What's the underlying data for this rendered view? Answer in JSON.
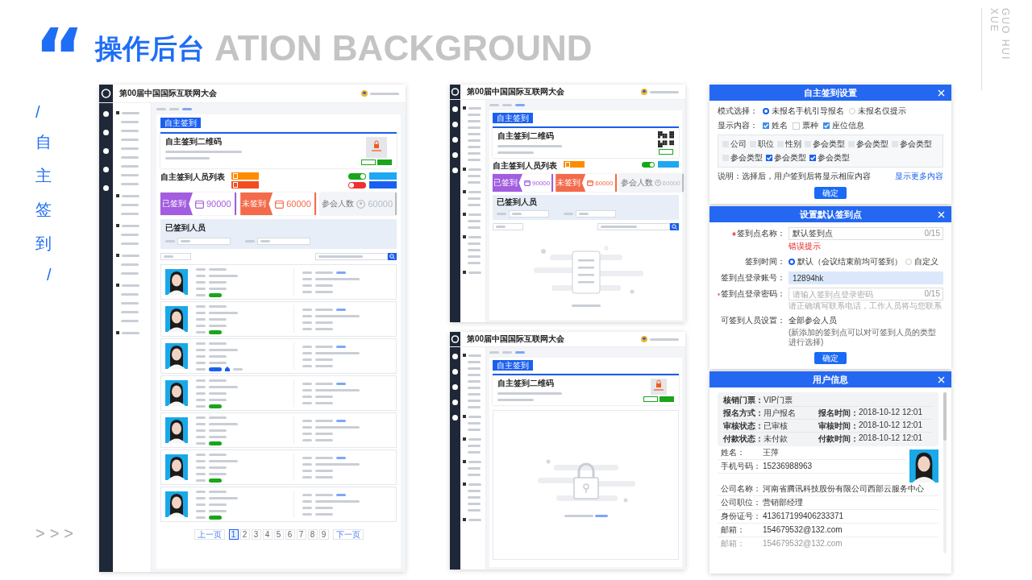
{
  "header": {
    "quote_mark": "“",
    "title": "操作后台",
    "backdrop": "ATION BACKGROUND",
    "author": "GUO HUI XUE"
  },
  "side_label": {
    "slash_top": "/",
    "text": "自主签到",
    "slash_bottom": "/",
    "arrows": ">>>"
  },
  "mockups": [
    {
      "kind": "list",
      "title": "第00届中国国际互联网大会",
      "tab": "自主签到",
      "qr_title": "自主签到二维码",
      "qr": {
        "kind": "placeholder"
      },
      "list_title": "自主签到人员列表",
      "export_buttons": [
        {
          "color": "#ff8c00"
        },
        {
          "color": "#f24d1f"
        }
      ],
      "switches": [
        {
          "on": true
        },
        {
          "on": false
        }
      ],
      "settings_buttons": [
        {
          "color": "#1ea7f2"
        },
        {
          "color": "#1a5ff0"
        }
      ],
      "stats": [
        {
          "kind": "highlight",
          "label": "已签到",
          "value": "90000",
          "color": "#a25de0"
        },
        {
          "kind": "highlight",
          "label": "未签到",
          "value": "60000",
          "color": "#f46a4a"
        },
        {
          "kind": "plain",
          "label": "参会人数",
          "value": "60000",
          "color": "#b5bcc6"
        }
      ],
      "filter_title": "已签到人员",
      "records": [
        {
          "kind": "plain",
          "color": "#1aa51a"
        },
        {
          "kind": "plain",
          "color": "#1aa51a"
        },
        {
          "kind": "venue",
          "color": "#1a5ff0"
        },
        {
          "kind": "plain",
          "color": "#1aa51a"
        },
        {
          "kind": "plain",
          "color": "#1aa51a"
        },
        {
          "kind": "plain",
          "color": "#1aa51a"
        },
        {
          "kind": "plain",
          "color": "#1aa51a"
        }
      ],
      "pagination": {
        "prev": "上一页",
        "pages": [
          {
            "label": "1",
            "selected": true
          },
          {
            "label": "2",
            "selected": false
          },
          {
            "label": "3",
            "selected": false
          },
          {
            "label": "4",
            "selected": false
          },
          {
            "label": "5",
            "selected": false
          },
          {
            "label": "6",
            "selected": false
          },
          {
            "label": "7",
            "selected": false
          },
          {
            "label": "8",
            "selected": false
          },
          {
            "label": "9",
            "selected": false
          }
        ],
        "next": "下一页"
      }
    },
    {
      "kind": "empty",
      "title": "第00届中国国际互联网大会",
      "tab": "自主签到",
      "qr_title": "自主签到二维码",
      "qr": {
        "kind": "code"
      },
      "list_title": "自主签到人员列表",
      "export_buttons": [
        {
          "color": "#ff8c00"
        }
      ],
      "switches": [
        {
          "on": true
        }
      ],
      "settings_buttons": [
        {
          "color": "#1ea7f2"
        }
      ],
      "stats": [
        {
          "kind": "highlight",
          "label": "已签到",
          "value": "90000",
          "color": "#a25de0"
        },
        {
          "kind": "highlight",
          "label": "未签到",
          "value": "60000",
          "color": "#f46a4a"
        },
        {
          "kind": "plain",
          "label": "参会人数",
          "value": "60000",
          "color": "#b5bcc6"
        }
      ],
      "filter_title": "已签到人员"
    },
    {
      "kind": "locked",
      "title": "第00届中国国际互联网大会",
      "tab": "自主签到",
      "qr_title": "自主签到二维码",
      "qr": {
        "kind": "placeholder"
      }
    }
  ],
  "dialogs": [
    {
      "kind": "checkin_settings",
      "title": "自主签到设置",
      "mode": {
        "label": "模式选择：",
        "options": [
          {
            "label": "未报名手机引导报名",
            "selected": true
          },
          {
            "label": "未报名仅提示",
            "selected": false
          }
        ]
      },
      "display": {
        "label": "显示内容：",
        "options": [
          {
            "label": "姓名",
            "checked": true
          },
          {
            "label": "票种",
            "checked": false
          },
          {
            "label": "座位信息",
            "checked": true
          }
        ]
      },
      "fields": [
        {
          "label": "公司",
          "checked": false
        },
        {
          "label": "职位",
          "checked": false
        },
        {
          "label": "性别",
          "checked": false
        },
        {
          "label": "参会类型",
          "checked": false
        },
        {
          "label": "参会类型",
          "checked": false
        },
        {
          "label": "参会类型",
          "checked": false
        },
        {
          "label": "参会类型",
          "checked": false
        },
        {
          "label": "参会类型",
          "checked": true
        },
        {
          "label": "参会类型",
          "checked": true
        }
      ],
      "note": "说明：选择后，用户签到后将显示相应内容",
      "more_link": "显示更多内容",
      "button": "确定"
    },
    {
      "kind": "checkpoint",
      "title": "设置默认签到点",
      "rows": [
        {
          "kind": "input",
          "label": "签到点名称：",
          "required": true,
          "value": "默认签到点",
          "counter": "0/15",
          "error": "错误提示"
        },
        {
          "kind": "radio",
          "label": "签到时间：",
          "options": [
            {
              "label": "默认（会议结束前均可签到）",
              "selected": true
            },
            {
              "label": "自定义",
              "selected": false
            }
          ]
        },
        {
          "kind": "input",
          "label": "签到点登录账号：",
          "required": false,
          "value": "12894hk",
          "focused": true
        },
        {
          "kind": "input",
          "label": "签到点登录密码：",
          "required": true,
          "placeholder": "请输入签到点登录密码",
          "counter": "0/15",
          "hint": "请正确填写联系电话，工作人员将与您联系"
        },
        {
          "kind": "text",
          "label": "可签到人员设置：",
          "value": "全部参会人员",
          "note": "(新添加的签到点可以对可签到人员的类型进行选择)"
        }
      ],
      "button": "确定"
    },
    {
      "kind": "user_info",
      "title": "用户信息",
      "summary": [
        [
          {
            "label": "核销门票：",
            "value": "VIP门票"
          }
        ],
        [
          {
            "label": "报名方式：",
            "value": "用户报名"
          },
          {
            "label": "报名时间：",
            "value": "2018-10-12  12:01"
          }
        ],
        [
          {
            "label": "审核状态：",
            "value": "已审核"
          },
          {
            "label": "审核时间：",
            "value": "2018-10-12  12:01"
          }
        ],
        [
          {
            "label": "付款状态：",
            "value": "未付款"
          },
          {
            "label": "付款时间：",
            "value": "2018-10-12  12:01"
          }
        ]
      ],
      "details": [
        {
          "label": "姓名：",
          "value": "王萍"
        },
        {
          "label": "手机号码：",
          "value": "15236988963"
        },
        {
          "label": "公司名称：",
          "value": "河南省腾讯科技股份有限公司西部云服务中心"
        },
        {
          "label": "公司职位：",
          "value": "营销部经理"
        },
        {
          "label": "身份证号：",
          "value": "413617199406233371"
        },
        {
          "label": "邮箱：",
          "value": "154679532@132.com"
        },
        {
          "label": "邮箱：",
          "value": "154679532@132.com"
        }
      ]
    }
  ]
}
